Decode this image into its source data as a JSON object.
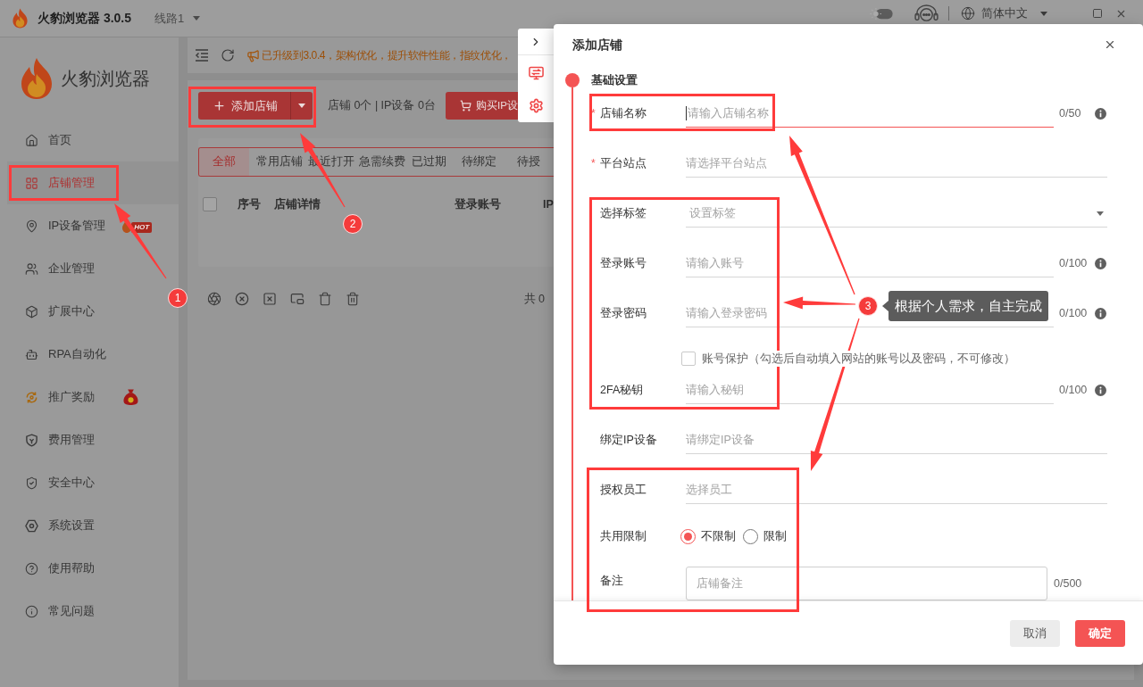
{
  "title_bar": {
    "app_name": "火豹浏览器 3.0.5",
    "route": "线路1",
    "language": "简体中文"
  },
  "sidebar": {
    "brand": "火豹浏览器",
    "items": [
      {
        "label": "首页",
        "selected": false
      },
      {
        "label": "店铺管理",
        "selected": true
      },
      {
        "label": "IP设备管理",
        "selected": false,
        "badge": {
          "kind": "hot",
          "text": "HOT"
        }
      },
      {
        "label": "企业管理",
        "selected": false
      },
      {
        "label": "扩展中心",
        "selected": false
      },
      {
        "label": "RPA自动化",
        "selected": false
      },
      {
        "label": "推广奖励",
        "selected": false,
        "badge": {
          "kind": "money_bag"
        }
      },
      {
        "label": "费用管理",
        "selected": false
      },
      {
        "label": "安全中心",
        "selected": false
      },
      {
        "label": "系统设置",
        "selected": false
      },
      {
        "label": "使用帮助",
        "selected": false
      },
      {
        "label": "常见问题",
        "selected": false
      }
    ]
  },
  "header": {
    "announcement": "已升级到3.0.4，架构优化，提升软件性能，指纹优化，"
  },
  "toolbar": {
    "add_button": "添加店铺",
    "stats": "店铺 0个 | IP设备 0台",
    "buy_button": "购买IP设"
  },
  "filter_tabs": [
    {
      "label": "全部",
      "selected": true
    },
    {
      "label": "常用店铺",
      "selected": false
    },
    {
      "label": "最近打开",
      "selected": false
    },
    {
      "label": "急需续费",
      "selected": false
    },
    {
      "label": "已过期",
      "selected": false
    },
    {
      "label": "待绑定",
      "selected": false
    },
    {
      "label": "待授",
      "selected": false
    }
  ],
  "table": {
    "select_all": {
      "checked": false
    },
    "columns": [
      "序号",
      "店铺详情",
      "登录账号",
      "IP"
    ]
  },
  "table_footer": {
    "total": "共 0"
  },
  "dialog": {
    "title": "添加店铺",
    "section": "基础设置",
    "fields": [
      {
        "kind": "text",
        "required_mark": "*",
        "label": "店铺名称",
        "placeholder": "请输入店铺名称",
        "counter": "0/50",
        "focused": true
      },
      {
        "kind": "text",
        "required_mark": "*",
        "label": "平台站点",
        "placeholder": "请选择平台站点",
        "focused": false
      },
      {
        "kind": "select",
        "label": "选择标签",
        "placeholder": "设置标签"
      },
      {
        "kind": "text",
        "label": "登录账号",
        "placeholder": "请输入账号",
        "counter": "0/100",
        "focused": false
      },
      {
        "kind": "text",
        "label": "登录密码",
        "placeholder": "请输入登录密码",
        "counter": "0/100",
        "focused": false
      },
      {
        "kind": "checkbox",
        "label": "账号保护（勾选后自动填入网站的账号以及密码，不可修改）",
        "checked": false
      },
      {
        "kind": "text",
        "label": "2FA秘钥",
        "placeholder": "请输入秘钥",
        "counter": "0/100",
        "focused": false
      },
      {
        "kind": "text",
        "label": "绑定IP设备",
        "placeholder": "请绑定IP设备",
        "focused": false
      },
      {
        "kind": "text",
        "label": "授权员工",
        "placeholder": "选择员工",
        "focused": false
      },
      {
        "kind": "radio",
        "label": "共用限制",
        "options": [
          {
            "label": "不限制",
            "selected": true
          },
          {
            "label": "限制",
            "selected": false
          }
        ]
      },
      {
        "kind": "textarea",
        "label": "备注",
        "placeholder": "店铺备注",
        "counter": "0/500"
      }
    ],
    "buttons": [
      {
        "label": "取消",
        "kind": "secondary"
      },
      {
        "label": "确定",
        "kind": "primary"
      }
    ]
  },
  "annotations": {
    "markers": [
      "1",
      "2",
      "3"
    ],
    "callout": "根据个人需求，自主完成"
  }
}
